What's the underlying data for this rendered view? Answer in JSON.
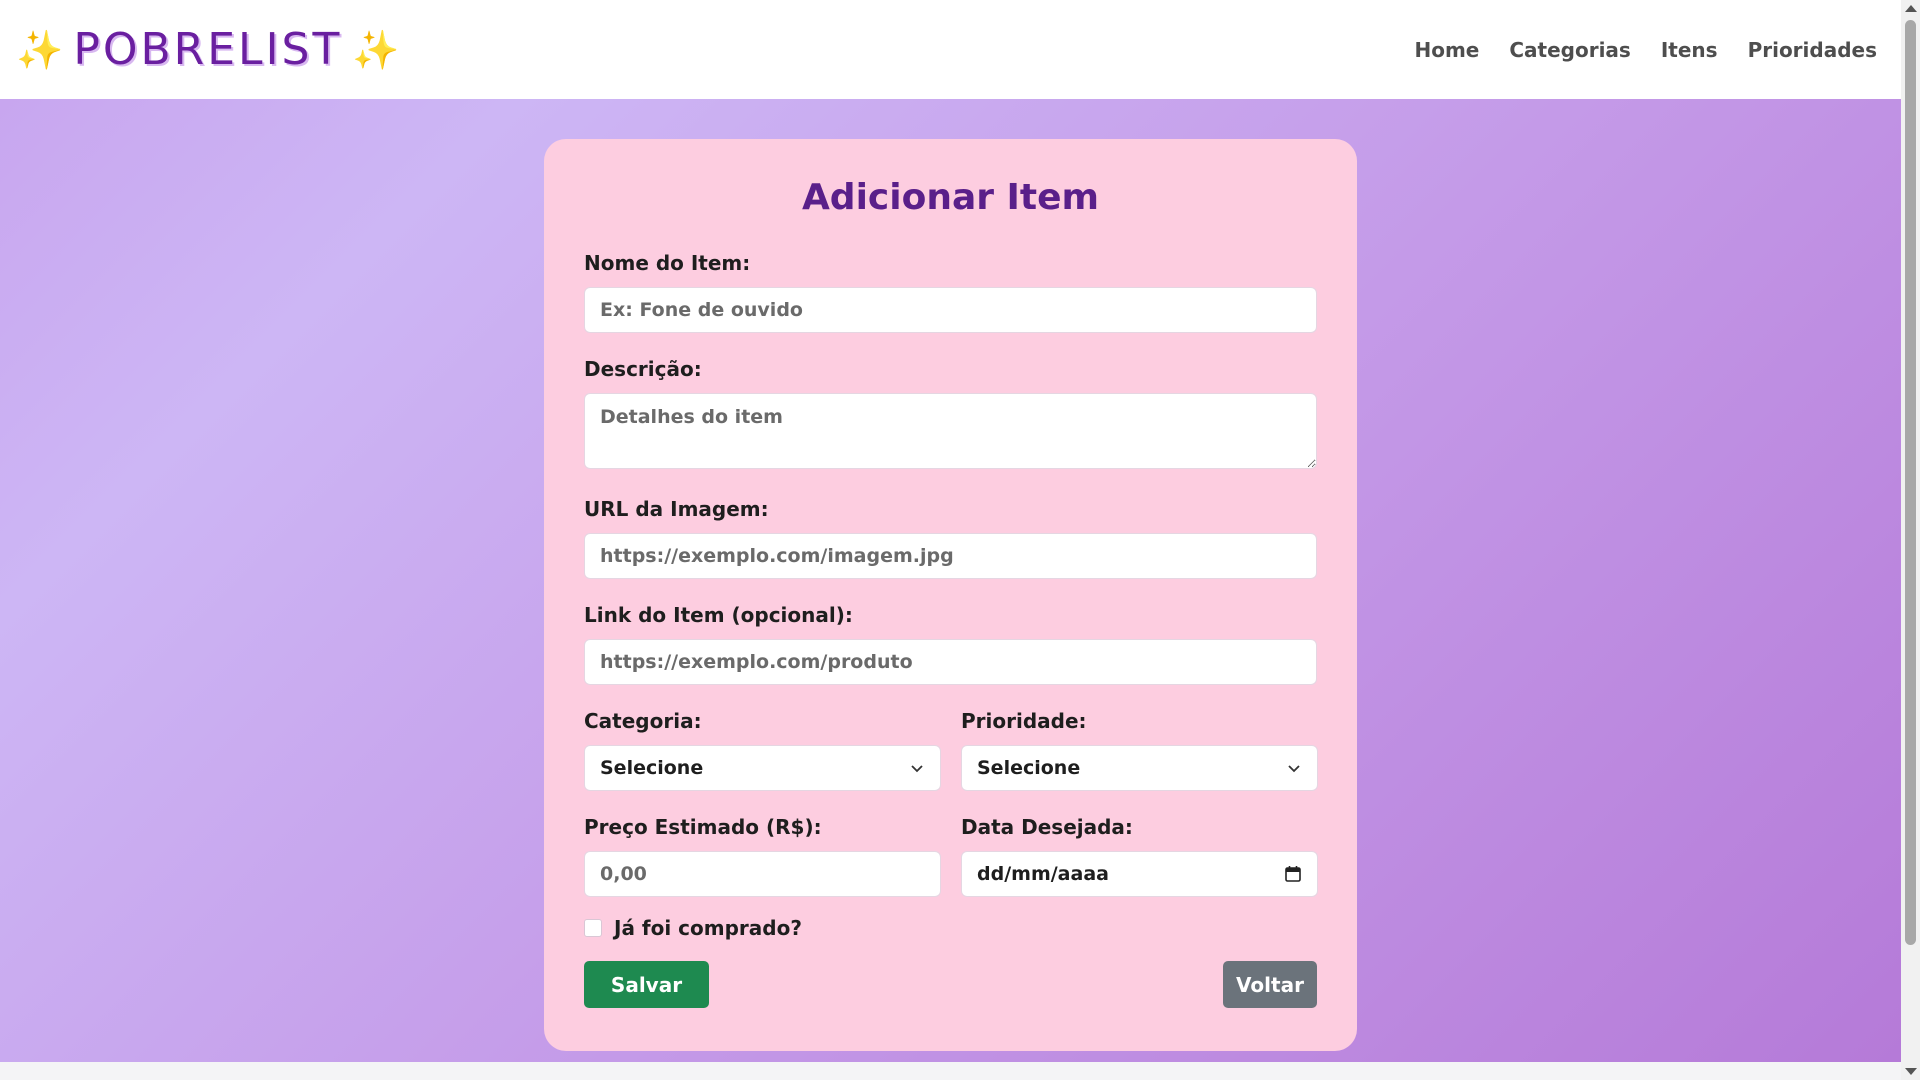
{
  "brand": {
    "sparkle_left": "✨",
    "name": "POBRELIST",
    "sparkle_right": "✨"
  },
  "nav": {
    "items": [
      "Home",
      "Categorias",
      "Itens",
      "Prioridades"
    ]
  },
  "form": {
    "title": "Adicionar Item",
    "name": {
      "label": "Nome do Item:",
      "placeholder": "Ex: Fone de ouvido"
    },
    "description": {
      "label": "Descrição:",
      "placeholder": "Detalhes do item"
    },
    "image_url": {
      "label": "URL da Imagem:",
      "placeholder": "https://exemplo.com/imagem.jpg"
    },
    "item_link": {
      "label": "Link do Item (opcional):",
      "placeholder": "https://exemplo.com/produto"
    },
    "category": {
      "label": "Categoria:",
      "value": "Selecione"
    },
    "priority": {
      "label": "Prioridade:",
      "value": "Selecione"
    },
    "price": {
      "label": "Preço Estimado (R$):",
      "placeholder": "0,00"
    },
    "date": {
      "label": "Data Desejada:",
      "placeholder": "dd/mm/aaaa"
    },
    "purchased": {
      "label": "Já foi comprado?",
      "checked": false
    },
    "save_label": "Salvar",
    "back_label": "Voltar"
  },
  "colors": {
    "brand": "#6a1fa0",
    "card_bg": "#fdcde0",
    "title": "#5a1f8a",
    "save_button": "#1e8a50",
    "back_button": "#6b737b",
    "sparkle": "#f6c21a"
  },
  "icons": [
    "sparkle-icon",
    "chevron-down-icon",
    "calendar-icon"
  ]
}
